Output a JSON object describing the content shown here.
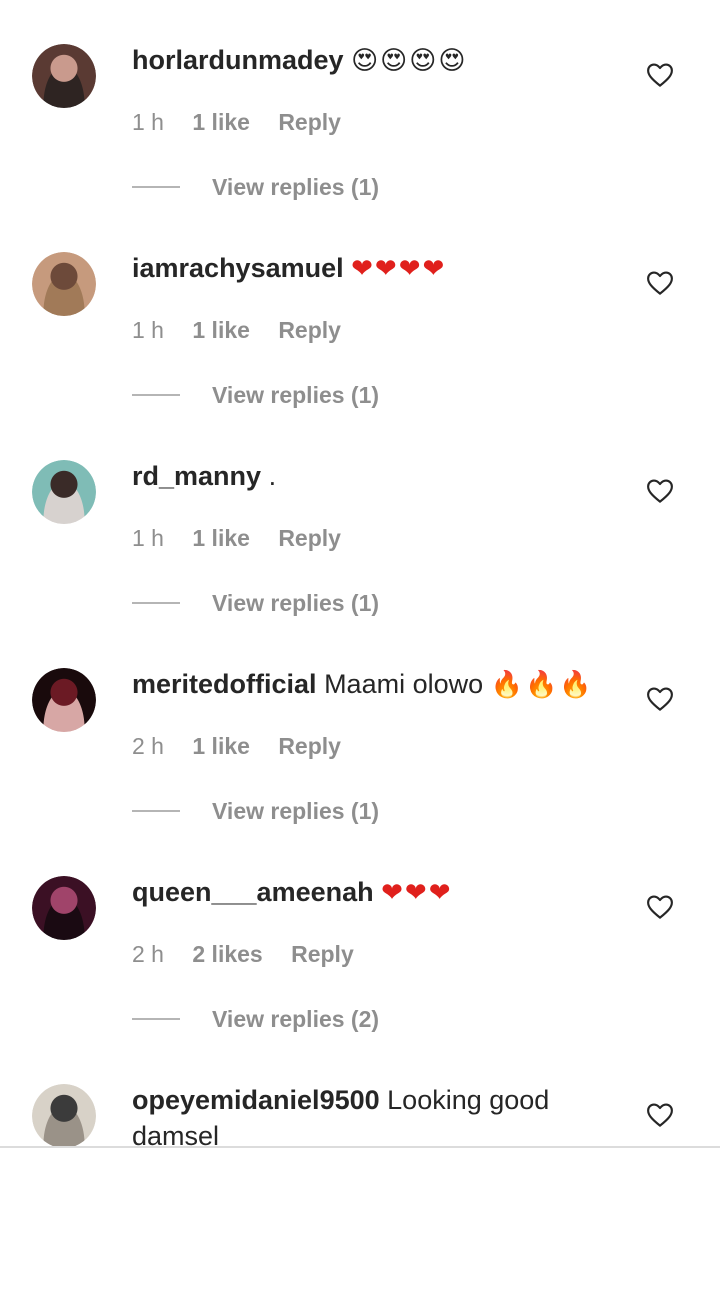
{
  "comments": [
    {
      "username": "horlardunmadey",
      "text": "",
      "emoji": "😍😍😍😍",
      "emoji_kind": "heart-eyes",
      "time": "1 h",
      "likes": "1 like",
      "reply": "Reply",
      "view_replies": "View replies (1)",
      "avatar_colors": [
        "#5a3a33",
        "#c99a8d",
        "#2e2422"
      ]
    },
    {
      "username": "iamrachysamuel",
      "text": "",
      "emoji": "❤❤❤❤",
      "emoji_kind": "red-heart",
      "time": "1 h",
      "likes": "1 like",
      "reply": "Reply",
      "view_replies": "View replies (1)",
      "avatar_colors": [
        "#c69a7d",
        "#6d4a3a",
        "#a17a58"
      ]
    },
    {
      "username": "rd_manny",
      "text": ".",
      "emoji": "",
      "emoji_kind": "",
      "time": "1 h",
      "likes": "1 like",
      "reply": "Reply",
      "view_replies": "View replies (1)",
      "avatar_colors": [
        "#7fbcb6",
        "#3a2b28",
        "#d7d2cf"
      ]
    },
    {
      "username": "meritedofficial",
      "text": "Maami olowo",
      "emoji": "🔥🔥🔥",
      "emoji_kind": "fire",
      "time": "2 h",
      "likes": "1 like",
      "reply": "Reply",
      "view_replies": "View replies (1)",
      "avatar_colors": [
        "#190a0c",
        "#6b1a24",
        "#d7a7a5"
      ]
    },
    {
      "username": "queen___ameenah",
      "text": "",
      "emoji": "❤❤❤",
      "emoji_kind": "red-heart",
      "time": "2 h",
      "likes": "2 likes",
      "reply": "Reply",
      "view_replies": "View replies (2)",
      "avatar_colors": [
        "#3b1024",
        "#a0446a",
        "#1a0a12"
      ]
    },
    {
      "username": "opeyemidaniel9500",
      "text": "Looking good damsel",
      "emoji": "",
      "emoji_kind": "",
      "time": "",
      "likes": "",
      "reply": "",
      "view_replies": "",
      "avatar_colors": [
        "#d8d2c8",
        "#3b3b3b",
        "#9a9288"
      ]
    }
  ],
  "icons": {
    "like": "heart-outline-icon"
  },
  "colors": {
    "text": "#262626",
    "secondary": "#8e8e8e",
    "divider": "#b5b5b5"
  }
}
